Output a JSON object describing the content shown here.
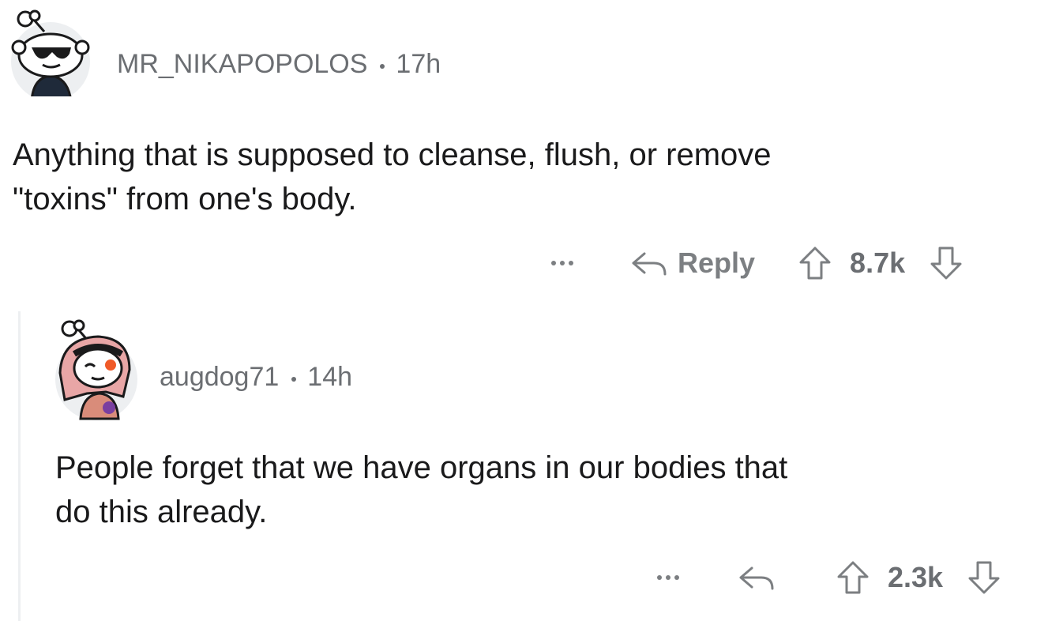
{
  "comments": [
    {
      "username": "MR_NIKAPOPOLOS",
      "time": "17h",
      "text_lines": [
        "Anything that is supposed to cleanse, flush, or remove",
        "\"toxins\" from one's body."
      ],
      "more_icon": "more-dots-icon",
      "reply_icon": "reply-arrow-icon",
      "reply_label": "Reply",
      "upvote_icon": "upvote-arrow-icon",
      "score": "8.7k",
      "downvote_icon": "downvote-arrow-icon"
    },
    {
      "username": "augdog71",
      "time": "14h",
      "text_lines": [
        "People forget that we have organs in our bodies that",
        "do this already."
      ],
      "more_icon": "more-dots-icon",
      "reply_icon": "reply-arrow-icon",
      "upvote_icon": "upvote-arrow-icon",
      "score": "2.3k",
      "downvote_icon": "downvote-arrow-icon"
    }
  ],
  "colors": {
    "meta_text": "#6b6e72",
    "body_text": "#1a1a1b",
    "action_gray": "#7c7f82",
    "thread_line": "#edeff1"
  }
}
